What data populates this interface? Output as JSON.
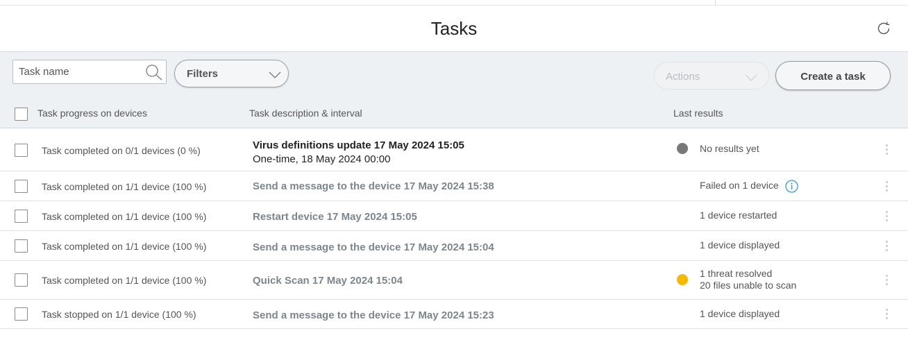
{
  "page": {
    "title": "Tasks"
  },
  "toolbar": {
    "search_placeholder": "Task name",
    "filters_label": "Filters",
    "actions_label": "Actions",
    "create_label": "Create a task"
  },
  "table": {
    "headers": {
      "progress": "Task progress on devices",
      "description": "Task description & interval",
      "results": "Last results"
    },
    "rows": [
      {
        "progress": "Task completed on 0/1 devices (0 %)",
        "description": "Virus definitions update 17 May 2024 15:05",
        "interval": "One-time, 18 May 2024 00:00",
        "result_lines": [
          "No results yet"
        ],
        "status": "gray"
      },
      {
        "progress": "Task completed on 1/1 device (100 %)",
        "description": "Send a message to the device 17 May 2024 15:38",
        "result_lines": [
          "Failed on 1 device"
        ],
        "status": "none",
        "info_icon": "info-icon"
      },
      {
        "progress": "Task completed on 1/1 device (100 %)",
        "description": "Restart device 17 May 2024 15:05",
        "result_lines": [
          "1 device restarted"
        ],
        "status": "none"
      },
      {
        "progress": "Task completed on 1/1 device (100 %)",
        "description": "Send a message to the device 17 May 2024 15:04",
        "result_lines": [
          "1 device displayed"
        ],
        "status": "none"
      },
      {
        "progress": "Task completed on 1/1 device (100 %)",
        "description": "Quick Scan 17 May 2024 15:04",
        "result_lines": [
          "1 threat resolved",
          "20 files unable to scan"
        ],
        "status": "yellow"
      },
      {
        "progress": "Task stopped on 1/1 device (100 %)",
        "description": "Send a message to the device 17 May 2024 15:23",
        "result_lines": [
          "1 device displayed"
        ],
        "status": "none"
      }
    ]
  },
  "colors": {
    "status_gray": "#787878",
    "status_yellow": "#f7b900",
    "info_accent": "#3a9ad9",
    "toolbar_bg": "#eef1f4"
  },
  "icons": {
    "refresh": "refresh-icon",
    "search": "search-icon",
    "chevron": "chevron-down-icon",
    "row_menu": "kebab-menu-icon"
  }
}
